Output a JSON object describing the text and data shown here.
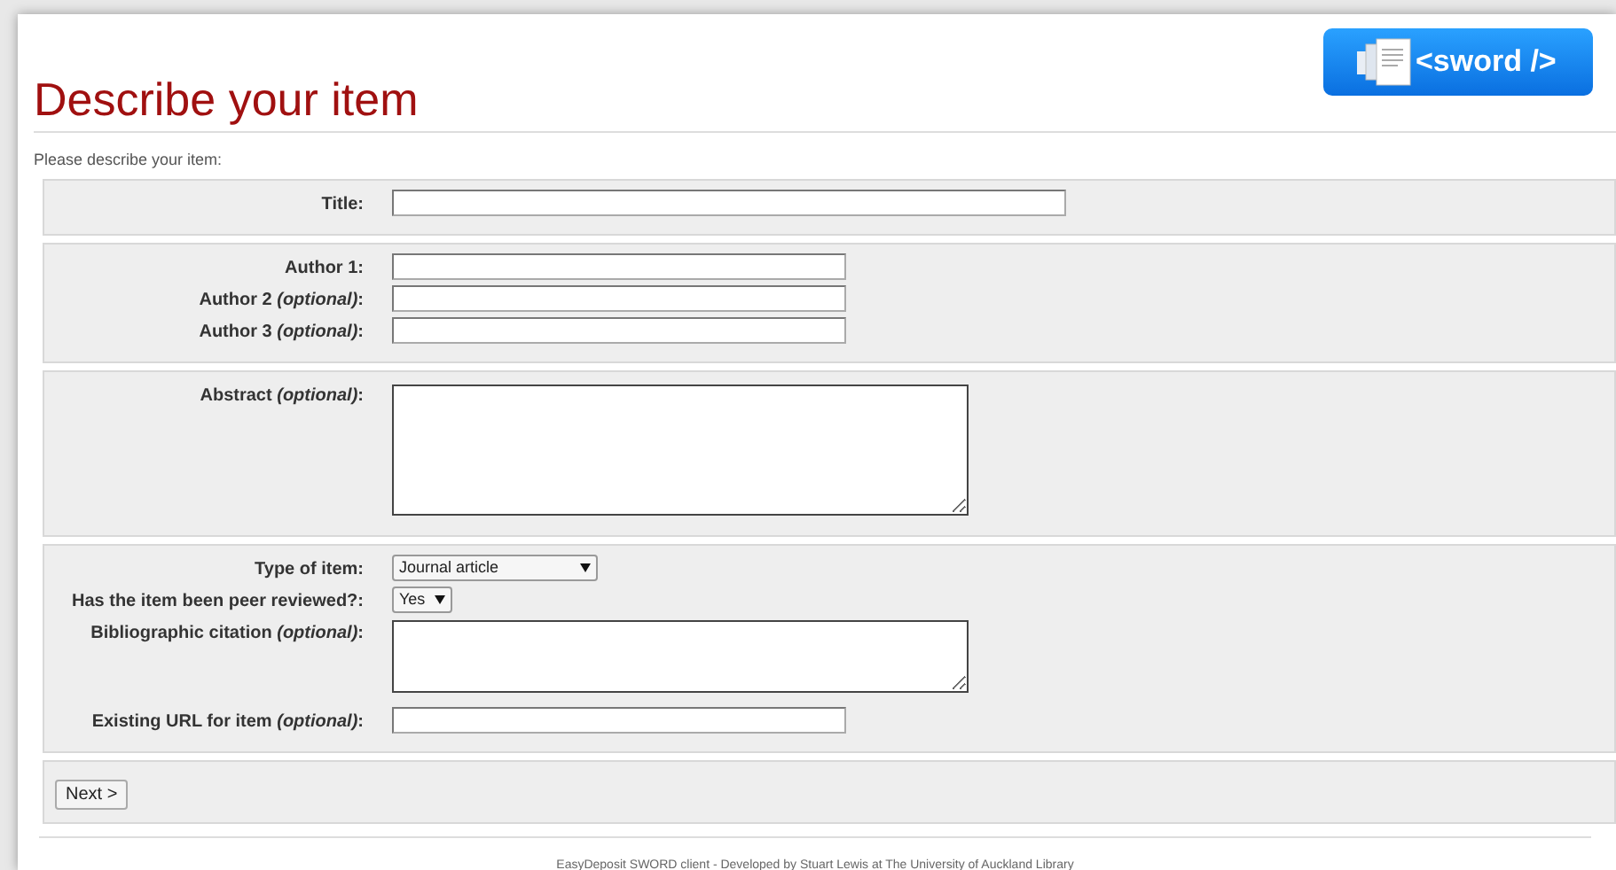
{
  "logo": {
    "text": "<sword />"
  },
  "heading": "Describe your item",
  "intro": "Please describe your item:",
  "sections": [
    {
      "fields": [
        {
          "kind": "text",
          "label": "Title:"
        }
      ]
    },
    {
      "fields": [
        {
          "kind": "text",
          "label": "Author 1:"
        },
        {
          "kind": "text",
          "label": "Author 2 *(optional)*:"
        },
        {
          "kind": "text",
          "label": "Author 3 *(optional)*:"
        }
      ]
    },
    {
      "fields": [
        {
          "kind": "textarea",
          "label": "Abstract *(optional)*:"
        }
      ]
    },
    {
      "fields": [
        {
          "kind": "select",
          "label": "Type of item:",
          "value": "Journal article"
        },
        {
          "kind": "select",
          "label": "Has the item been peer reviewed?:",
          "value": "Yes"
        },
        {
          "kind": "textarea",
          "label": "Bibliographic citation *(optional)*:"
        },
        {
          "kind": "text",
          "label": "Existing URL for item *(optional)*:"
        }
      ]
    }
  ],
  "next_button": "Next >",
  "footer": "EasyDeposit SWORD client - Developed by Stuart Lewis at The University of Auckland Library"
}
